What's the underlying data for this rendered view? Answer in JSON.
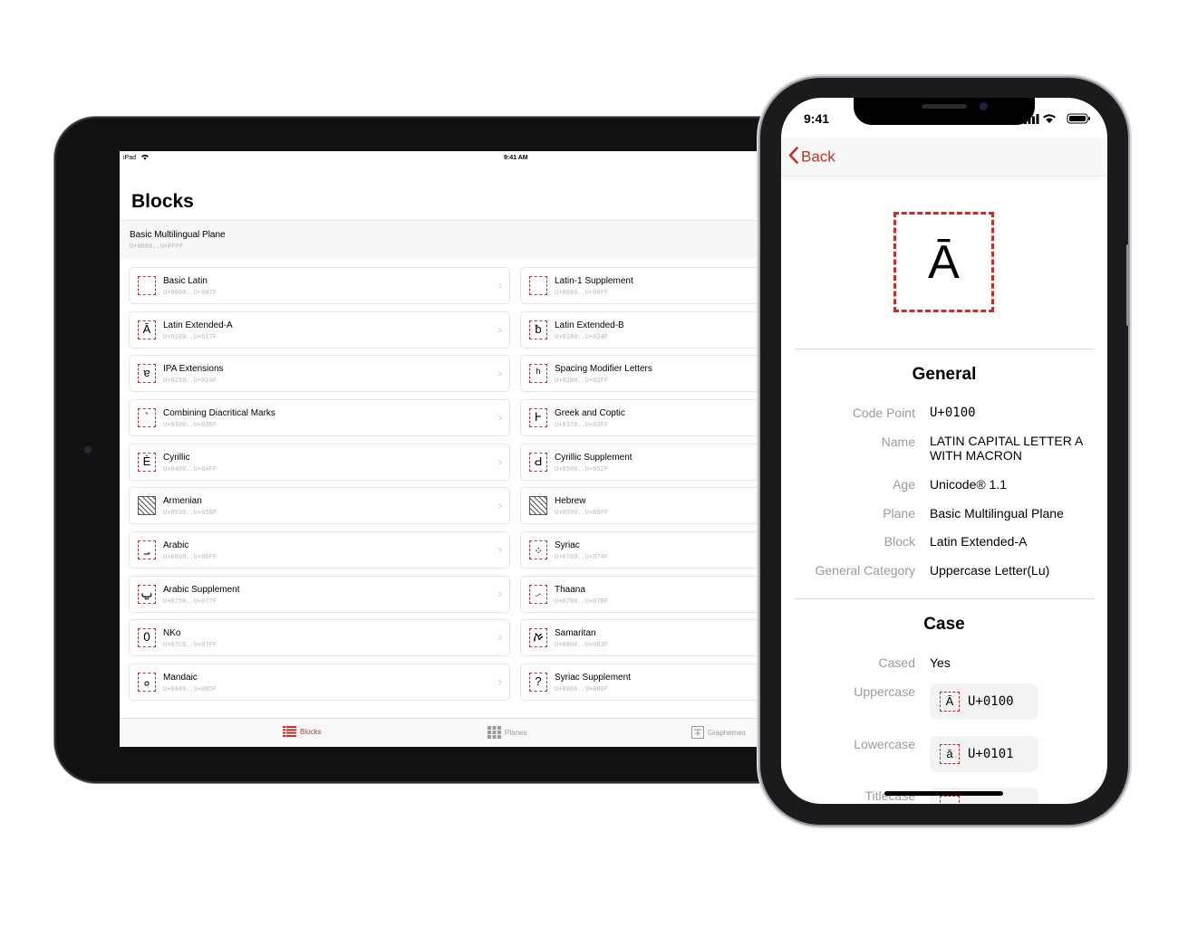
{
  "colors": {
    "accent": "#c0302c"
  },
  "ipad": {
    "status": {
      "device": "iPad",
      "time": "9:41 AM",
      "wifi_icon": "wifi-icon"
    },
    "title": "Blocks",
    "plane": {
      "name": "Basic Multilingual Plane",
      "range": "U+0000..U+FFFF"
    },
    "blocks": [
      {
        "name": "Basic Latin",
        "range": "U+0000..U+007F",
        "glyph": ""
      },
      {
        "name": "Latin-1 Supplement",
        "range": "U+0080..U+00FF",
        "glyph": ""
      },
      {
        "name": "Latin Extended-A",
        "range": "U+0100..U+017F",
        "glyph": "Ā"
      },
      {
        "name": "Latin Extended-B",
        "range": "U+0180..U+024F",
        "glyph": "ƀ"
      },
      {
        "name": "IPA Extensions",
        "range": "U+0250..U+02AF",
        "glyph": "ɐ"
      },
      {
        "name": "Spacing Modifier Letters",
        "range": "U+02B0..U+02FF",
        "glyph": "ʰ"
      },
      {
        "name": "Combining Diacritical Marks",
        "range": "U+0300..U+036F",
        "glyph": "`"
      },
      {
        "name": "Greek and Coptic",
        "range": "U+0370..U+03FF",
        "glyph": "Ͱ"
      },
      {
        "name": "Cyrillic",
        "range": "U+0400..U+04FF",
        "glyph": "Ѐ"
      },
      {
        "name": "Cyrillic Supplement",
        "range": "U+0500..U+052F",
        "glyph": "Ԁ"
      },
      {
        "name": "Armenian",
        "range": "U+0530..U+058F",
        "glyph": ""
      },
      {
        "name": "Hebrew",
        "range": "U+0590..U+05FF",
        "glyph": ""
      },
      {
        "name": "Arabic",
        "range": "U+0600..U+06FF",
        "glyph": "؀"
      },
      {
        "name": "Syriac",
        "range": "U+0700..U+074F",
        "glyph": "܀"
      },
      {
        "name": "Arabic Supplement",
        "range": "U+0750..U+077F",
        "glyph": "ݐ"
      },
      {
        "name": "Thaana",
        "range": "U+0780..U+07BF",
        "glyph": "ހ"
      },
      {
        "name": "NKo",
        "range": "U+07C0..U+07FF",
        "glyph": "߀"
      },
      {
        "name": "Samaritan",
        "range": "U+0800..U+083F",
        "glyph": "ࠀ"
      },
      {
        "name": "Mandaic",
        "range": "U+0840..U+085F",
        "glyph": "ࡀ"
      },
      {
        "name": "Syriac Supplement",
        "range": "U+0860..U+086F",
        "glyph": "?"
      }
    ],
    "tabs": [
      {
        "label": "Blocks",
        "icon": "list-icon"
      },
      {
        "label": "Planes",
        "icon": "grid-icon"
      },
      {
        "label": "Graphemes",
        "icon": "text-icon"
      }
    ]
  },
  "iphone": {
    "status": {
      "time": "9:41"
    },
    "nav": {
      "back_label": "Back"
    },
    "character": "Ā",
    "general": {
      "title": "General",
      "rows": [
        {
          "label": "Code Point",
          "value": "U+0100"
        },
        {
          "label": "Name",
          "value": "LATIN CAPITAL LETTER A WITH MACRON"
        },
        {
          "label": "Age",
          "value": "Unicode® 1.1"
        },
        {
          "label": "Plane",
          "value": "Basic Multilingual Plane"
        },
        {
          "label": "Block",
          "value": "Latin Extended-A"
        },
        {
          "label": "General Category",
          "value": "Uppercase Letter(Lu)"
        }
      ]
    },
    "case": {
      "title": "Case",
      "cased_label": "Cased",
      "cased_value": "Yes",
      "uppercase": {
        "label": "Uppercase",
        "glyph": "Ā",
        "code": "U+0100"
      },
      "lowercase": {
        "label": "Lowercase",
        "glyph": "ā",
        "code": "U+0101"
      },
      "titlecase": {
        "label": "Titlecase"
      }
    }
  }
}
